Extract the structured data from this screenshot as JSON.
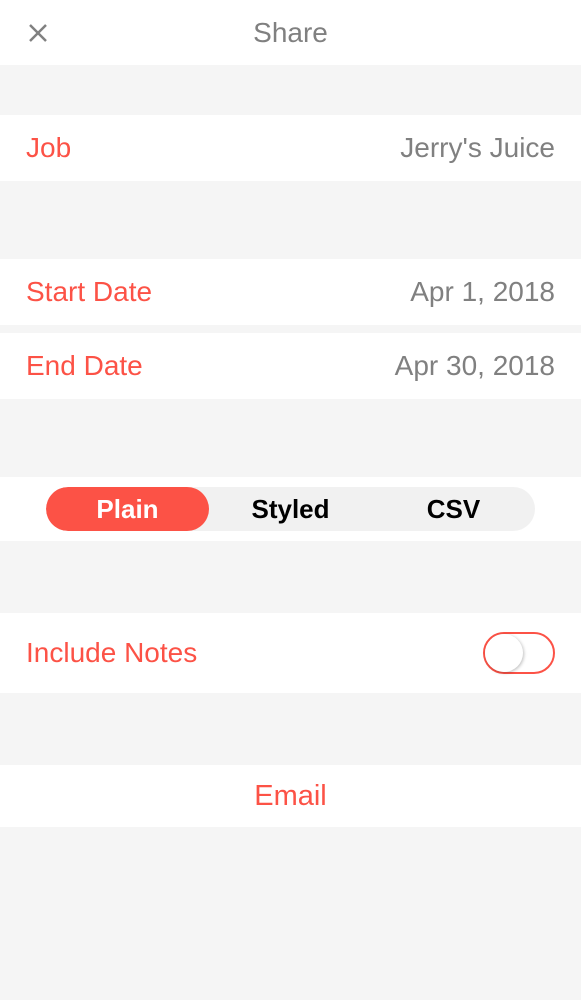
{
  "header": {
    "title": "Share"
  },
  "job": {
    "label": "Job",
    "value": "Jerry's Juice"
  },
  "startDate": {
    "label": "Start Date",
    "value": "Apr 1, 2018"
  },
  "endDate": {
    "label": "End Date",
    "value": "Apr 30, 2018"
  },
  "format": {
    "options": {
      "plain": "Plain",
      "styled": "Styled",
      "csv": "CSV"
    },
    "selected": "plain"
  },
  "notes": {
    "label": "Include Notes",
    "enabled": false
  },
  "action": {
    "email": "Email"
  }
}
